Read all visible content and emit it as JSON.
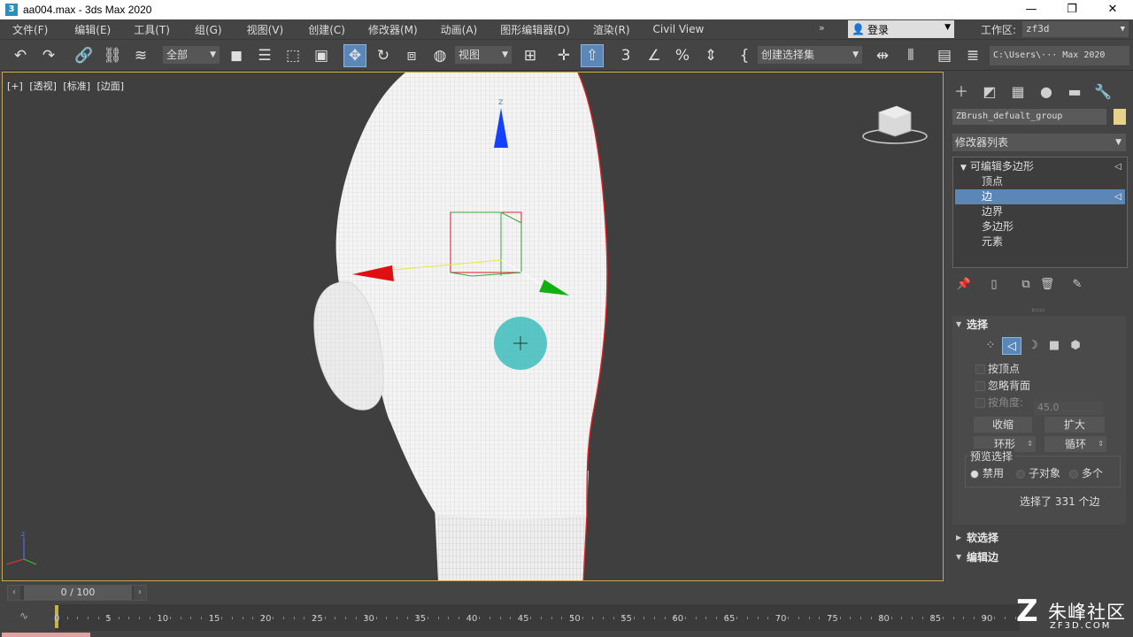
{
  "window": {
    "title": "aa004.max - 3ds Max 2020",
    "minimize": "—",
    "maximize": "❐",
    "close": "✕"
  },
  "menu": {
    "items": [
      "文件(F)",
      "编辑(E)",
      "工具(T)",
      "组(G)",
      "视图(V)",
      "创建(C)",
      "修改器(M)",
      "动画(A)",
      "图形编辑器(D)",
      "渲染(R)",
      "Civil View"
    ],
    "more": "»",
    "login": "登录",
    "workspace_label": "工作区:",
    "workspace_value": "zf3d"
  },
  "toolbar": {
    "selection_filter": "全部",
    "ref_coord": "视图",
    "named_selection": "创建选择集",
    "path": "C:\\Users\\··· Max 2020"
  },
  "viewport": {
    "labels": [
      "[+]",
      "[透视]",
      "[标准]",
      "[边面]"
    ],
    "axis_z": "z",
    "tripod_z": "z"
  },
  "command_panel": {
    "object_name": "ZBrush_defualt_group",
    "object_color": "#e8d28a",
    "modifier_list": "修改器列表",
    "stack": {
      "root": "可编辑多边形",
      "items": [
        "顶点",
        "边",
        "边界",
        "多边形",
        "元素"
      ],
      "selected_index": 1
    },
    "selection": {
      "title": "选择",
      "by_vertex": "按顶点",
      "ignore_backfacing": "忽略背面",
      "by_angle": "按角度:",
      "angle_value": "45.0",
      "shrink": "收缩",
      "grow": "扩大",
      "ring": "环形",
      "loop": "循环",
      "preview_title": "预览选择",
      "preview_options": [
        "禁用",
        "子对象",
        "多个"
      ],
      "status": "选择了 331 个边"
    },
    "soft_selection": "软选择",
    "edit_edges": "编辑边"
  },
  "timeline": {
    "frame_display": "0 / 100",
    "ticks": [
      "0",
      "5",
      "10",
      "15",
      "20",
      "25",
      "30",
      "35",
      "40",
      "45",
      "50",
      "55",
      "60",
      "65",
      "70",
      "75",
      "80",
      "85",
      "90"
    ]
  },
  "watermark": {
    "logo": "Z",
    "name": "朱峰社区",
    "url": "ZF3D.COM"
  }
}
